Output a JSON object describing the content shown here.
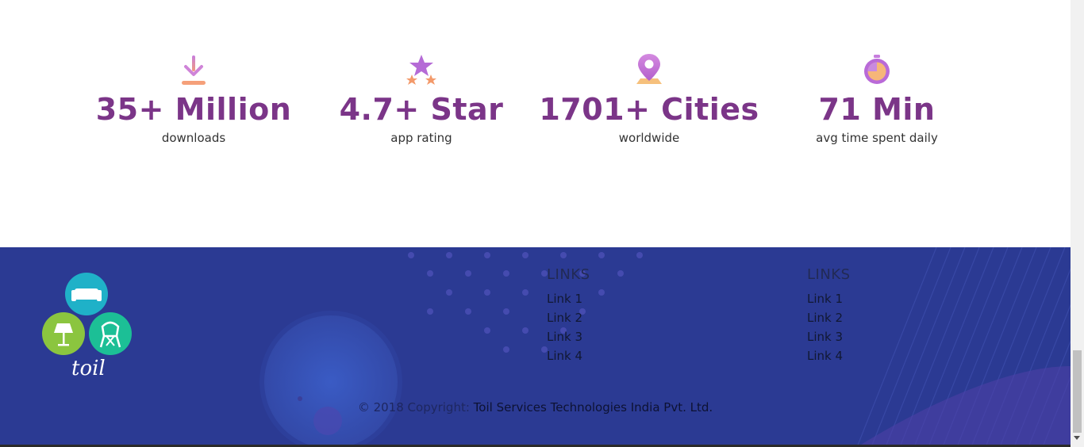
{
  "stats": [
    {
      "icon": "download-icon",
      "value": "35+ Million",
      "label": "downloads"
    },
    {
      "icon": "star-rating-icon",
      "value": "4.7+ Star",
      "label": "app rating"
    },
    {
      "icon": "location-pin-icon",
      "value": "1701+ Cities",
      "label": "worldwide"
    },
    {
      "icon": "stopwatch-icon",
      "value": "71 Min",
      "label": "avg time spent daily"
    }
  ],
  "footer": {
    "logo_text": "toil",
    "columns": [
      {
        "title": "LINKS",
        "links": [
          "Link 1",
          "Link 2",
          "Link 3",
          "Link 4"
        ]
      },
      {
        "title": "LINKS",
        "links": [
          "Link 1",
          "Link 2",
          "Link 3",
          "Link 4"
        ]
      }
    ],
    "copyright_prefix": "© 2018 Copyright:",
    "copyright_company": "Toil Services Technologies India Pvt. Ltd."
  },
  "colors": {
    "stat_value": "#7b3588",
    "footer_bg": "#2b3a93",
    "logo_teal": "#1fb1c8",
    "logo_green": "#8bc53f",
    "logo_mint": "#1cbf96"
  }
}
